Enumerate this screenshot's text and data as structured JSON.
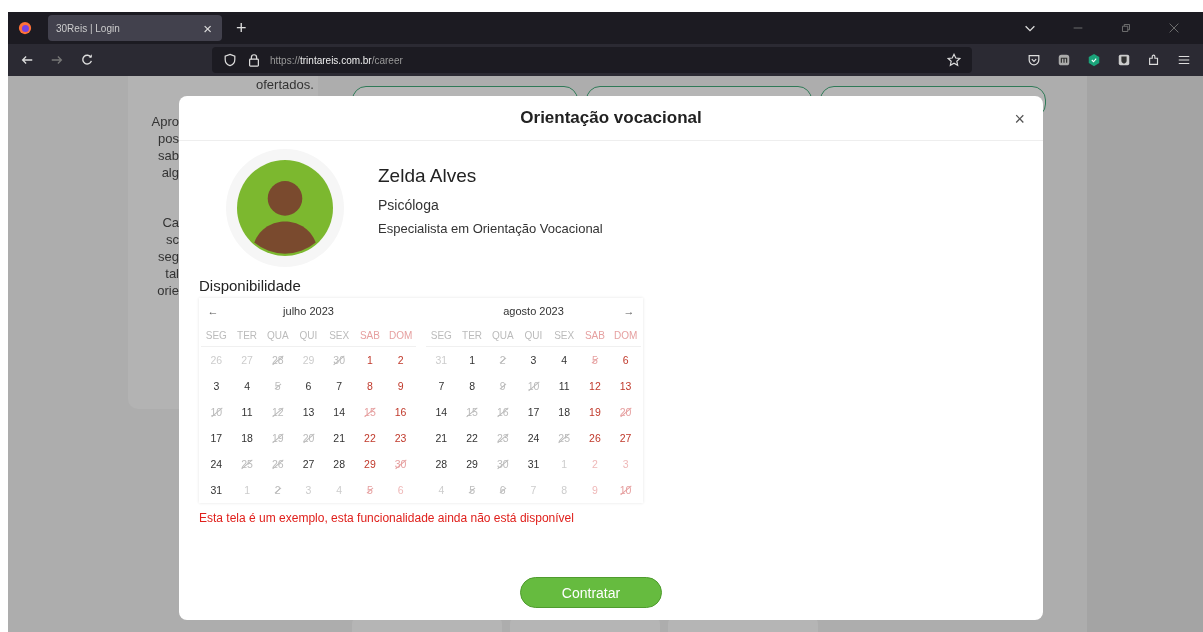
{
  "browser": {
    "tabs": [
      {
        "title": "30Reis | Login",
        "close": "×",
        "selected": true
      }
    ],
    "new_tab": "+",
    "url": {
      "scheme": "https://",
      "host": "trintareis.com.br",
      "path": "/career"
    }
  },
  "background_page": {
    "top_text": "ofertados.",
    "side_fragments": [
      [
        "Apro",
        "pos",
        "sab",
        "alg"
      ],
      [
        "Ca",
        "sc",
        "seg",
        "tal",
        "orie"
      ]
    ]
  },
  "modal": {
    "title": "Orientação vocacional",
    "close": "×",
    "profile": {
      "name": "Zelda Alves",
      "role": "Psicóloga",
      "specialty": "Especialista em Orientação Vocacional"
    },
    "availability_label": "Disponibilidade",
    "calendar": {
      "months": [
        {
          "title": "julho 2023",
          "prev": "←",
          "weekdays": [
            "SEG",
            "TER",
            "QUA",
            "QUI",
            "SEX",
            "SAB",
            "DOM"
          ],
          "weeks": [
            [
              {
                "day": "26",
                "outside": true,
                "unavailable": false
              },
              {
                "day": "27",
                "outside": true,
                "unavailable": false
              },
              {
                "day": "28",
                "outside": true,
                "unavailable": true
              },
              {
                "day": "29",
                "outside": true,
                "unavailable": false
              },
              {
                "day": "30",
                "outside": true,
                "unavailable": true
              },
              {
                "day": "1",
                "outside": false,
                "unavailable": false
              },
              {
                "day": "2",
                "outside": false,
                "unavailable": false
              }
            ],
            [
              {
                "day": "3",
                "outside": false,
                "unavailable": false
              },
              {
                "day": "4",
                "outside": false,
                "unavailable": false
              },
              {
                "day": "5",
                "outside": false,
                "unavailable": true
              },
              {
                "day": "6",
                "outside": false,
                "unavailable": false
              },
              {
                "day": "7",
                "outside": false,
                "unavailable": false
              },
              {
                "day": "8",
                "outside": false,
                "unavailable": false
              },
              {
                "day": "9",
                "outside": false,
                "unavailable": false
              }
            ],
            [
              {
                "day": "10",
                "outside": false,
                "unavailable": true
              },
              {
                "day": "11",
                "outside": false,
                "unavailable": false
              },
              {
                "day": "12",
                "outside": false,
                "unavailable": true
              },
              {
                "day": "13",
                "outside": false,
                "unavailable": false
              },
              {
                "day": "14",
                "outside": false,
                "unavailable": false
              },
              {
                "day": "15",
                "outside": false,
                "unavailable": true
              },
              {
                "day": "16",
                "outside": false,
                "unavailable": false
              }
            ],
            [
              {
                "day": "17",
                "outside": false,
                "unavailable": false
              },
              {
                "day": "18",
                "outside": false,
                "unavailable": false
              },
              {
                "day": "19",
                "outside": false,
                "unavailable": true
              },
              {
                "day": "20",
                "outside": false,
                "unavailable": true
              },
              {
                "day": "21",
                "outside": false,
                "unavailable": false
              },
              {
                "day": "22",
                "outside": false,
                "unavailable": false
              },
              {
                "day": "23",
                "outside": false,
                "unavailable": false
              }
            ],
            [
              {
                "day": "24",
                "outside": false,
                "unavailable": false
              },
              {
                "day": "25",
                "outside": false,
                "unavailable": true
              },
              {
                "day": "26",
                "outside": false,
                "unavailable": true
              },
              {
                "day": "27",
                "outside": false,
                "unavailable": false
              },
              {
                "day": "28",
                "outside": false,
                "unavailable": false
              },
              {
                "day": "29",
                "outside": false,
                "unavailable": false
              },
              {
                "day": "30",
                "outside": false,
                "unavailable": true
              }
            ],
            [
              {
                "day": "31",
                "outside": false,
                "unavailable": false
              },
              {
                "day": "1",
                "outside": true,
                "unavailable": false
              },
              {
                "day": "2",
                "outside": true,
                "unavailable": true
              },
              {
                "day": "3",
                "outside": true,
                "unavailable": false
              },
              {
                "day": "4",
                "outside": true,
                "unavailable": false
              },
              {
                "day": "5",
                "outside": true,
                "unavailable": true
              },
              {
                "day": "6",
                "outside": true,
                "unavailable": false
              }
            ]
          ]
        },
        {
          "title": "agosto 2023",
          "next": "→",
          "weekdays": [
            "SEG",
            "TER",
            "QUA",
            "QUI",
            "SEX",
            "SAB",
            "DOM"
          ],
          "weeks": [
            [
              {
                "day": "31",
                "outside": true,
                "unavailable": false
              },
              {
                "day": "1",
                "outside": false,
                "unavailable": false
              },
              {
                "day": "2",
                "outside": false,
                "unavailable": true
              },
              {
                "day": "3",
                "outside": false,
                "unavailable": false
              },
              {
                "day": "4",
                "outside": false,
                "unavailable": false
              },
              {
                "day": "5",
                "outside": false,
                "unavailable": true
              },
              {
                "day": "6",
                "outside": false,
                "unavailable": false
              }
            ],
            [
              {
                "day": "7",
                "outside": false,
                "unavailable": false
              },
              {
                "day": "8",
                "outside": false,
                "unavailable": false
              },
              {
                "day": "9",
                "outside": false,
                "unavailable": true
              },
              {
                "day": "10",
                "outside": false,
                "unavailable": true
              },
              {
                "day": "11",
                "outside": false,
                "unavailable": false
              },
              {
                "day": "12",
                "outside": false,
                "unavailable": false
              },
              {
                "day": "13",
                "outside": false,
                "unavailable": false
              }
            ],
            [
              {
                "day": "14",
                "outside": false,
                "unavailable": false
              },
              {
                "day": "15",
                "outside": false,
                "unavailable": true
              },
              {
                "day": "16",
                "outside": false,
                "unavailable": true
              },
              {
                "day": "17",
                "outside": false,
                "unavailable": false
              },
              {
                "day": "18",
                "outside": false,
                "unavailable": false
              },
              {
                "day": "19",
                "outside": false,
                "unavailable": false
              },
              {
                "day": "20",
                "outside": false,
                "unavailable": true
              }
            ],
            [
              {
                "day": "21",
                "outside": false,
                "unavailable": false
              },
              {
                "day": "22",
                "outside": false,
                "unavailable": false
              },
              {
                "day": "23",
                "outside": false,
                "unavailable": true
              },
              {
                "day": "24",
                "outside": false,
                "unavailable": false
              },
              {
                "day": "25",
                "outside": false,
                "unavailable": true
              },
              {
                "day": "26",
                "outside": false,
                "unavailable": false
              },
              {
                "day": "27",
                "outside": false,
                "unavailable": false
              }
            ],
            [
              {
                "day": "28",
                "outside": false,
                "unavailable": false
              },
              {
                "day": "29",
                "outside": false,
                "unavailable": false
              },
              {
                "day": "30",
                "outside": false,
                "unavailable": true
              },
              {
                "day": "31",
                "outside": false,
                "unavailable": false
              },
              {
                "day": "1",
                "outside": true,
                "unavailable": false
              },
              {
                "day": "2",
                "outside": true,
                "unavailable": false
              },
              {
                "day": "3",
                "outside": true,
                "unavailable": false
              }
            ],
            [
              {
                "day": "4",
                "outside": true,
                "unavailable": false
              },
              {
                "day": "5",
                "outside": true,
                "unavailable": true
              },
              {
                "day": "6",
                "outside": true,
                "unavailable": true
              },
              {
                "day": "7",
                "outside": true,
                "unavailable": false
              },
              {
                "day": "8",
                "outside": true,
                "unavailable": false
              },
              {
                "day": "9",
                "outside": true,
                "unavailable": false
              },
              {
                "day": "10",
                "outside": true,
                "unavailable": true
              }
            ]
          ]
        }
      ]
    },
    "notice": "Esta tela é um exemplo, esta funcionalidade ainda não está disponível",
    "button": "Contratar"
  }
}
